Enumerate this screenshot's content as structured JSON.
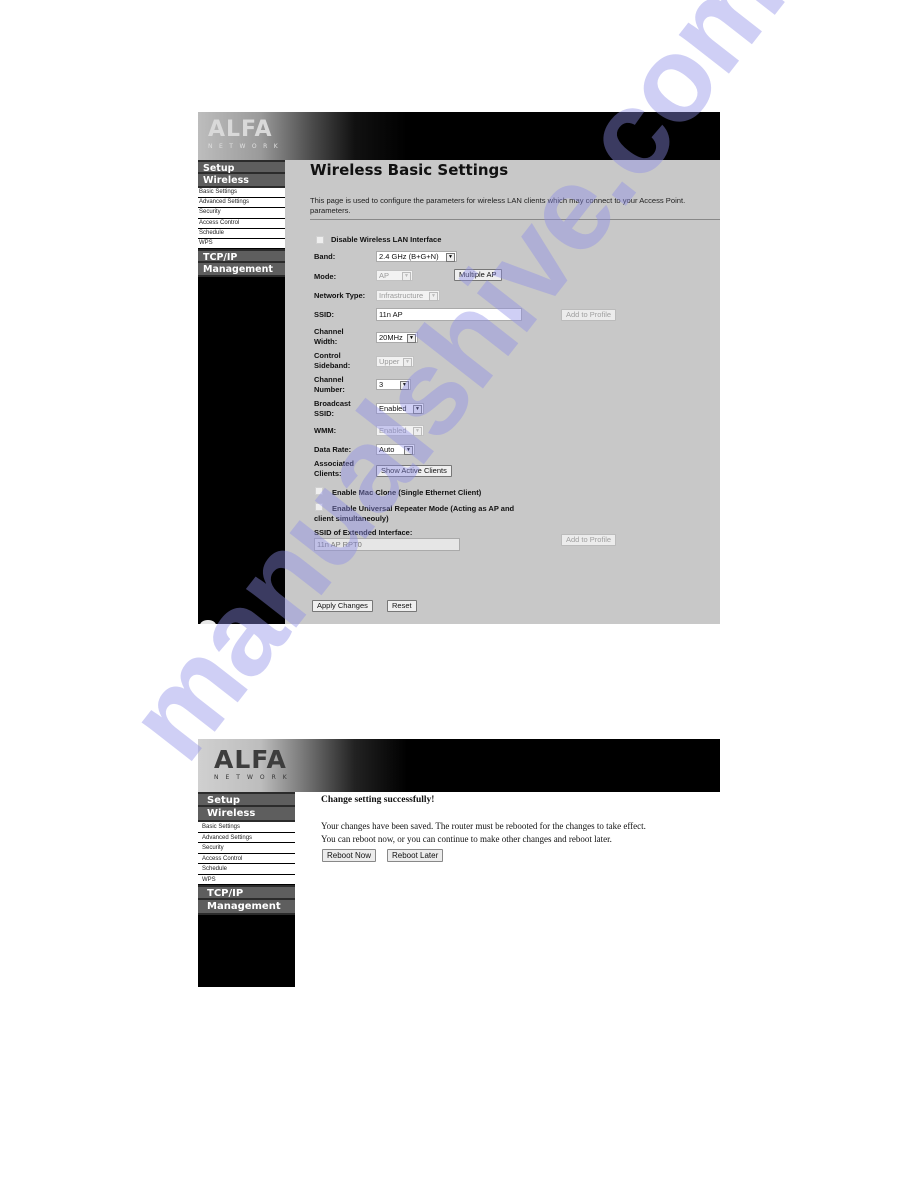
{
  "brand": {
    "logo_word": "ALFA",
    "logo_sub": "NETWORK"
  },
  "sidebar": {
    "sections": [
      {
        "label": "Setup"
      },
      {
        "label": "Wireless"
      },
      {
        "label": "TCP/IP"
      },
      {
        "label": "Management"
      }
    ],
    "wireless_items": [
      {
        "label": "Basic Settings"
      },
      {
        "label": "Advanced Settings"
      },
      {
        "label": "Security"
      },
      {
        "label": "Access Control"
      },
      {
        "label": "Schedule"
      },
      {
        "label": "WPS"
      }
    ]
  },
  "settings_page": {
    "title": "Wireless Basic Settings",
    "description": "This page is used to configure the parameters for wireless LAN clients which may connect to your Access Point.",
    "description_line2": "parameters.",
    "disable_wlan": {
      "label": "Disable Wireless LAN Interface",
      "checked": false
    },
    "band": {
      "label": "Band:",
      "value": "2.4 GHz (B+G+N)"
    },
    "mode": {
      "label": "Mode:",
      "value": "AP",
      "multiple_ap_button": "Multiple AP"
    },
    "network_type": {
      "label": "Network Type:",
      "value": "Infrastructure"
    },
    "ssid": {
      "label": "SSID:",
      "value": "11n AP",
      "add_to_profile_button": "Add to Profile"
    },
    "channel_width": {
      "label_line1": "Channel",
      "label_line2": "Width:",
      "value": "20MHz"
    },
    "control_sideband": {
      "label_line1": "Control",
      "label_line2": "Sideband:",
      "value": "Upper"
    },
    "channel_number": {
      "label_line1": "Channel",
      "label_line2": "Number:",
      "value": "3"
    },
    "broadcast_ssid": {
      "label_line1": "Broadcast",
      "label_line2": "SSID:",
      "value": "Enabled"
    },
    "wmm": {
      "label": "WMM:",
      "value": "Enabled"
    },
    "data_rate": {
      "label": "Data Rate:",
      "value": "Auto"
    },
    "associated_clients": {
      "label_line1": "Associated",
      "label_line2": "Clients:",
      "button": "Show Active Clients"
    },
    "mac_clone": {
      "label": "Enable Mac Clone (Single Ethernet Client)",
      "checked": false
    },
    "universal_repeater": {
      "label_line1": "Enable Universal Repeater Mode (Acting as AP and",
      "label_line2": "client simultaneouly)",
      "checked": false
    },
    "extended_ssid": {
      "label": "SSID of Extended Interface:",
      "value": "11n AP RPT0",
      "add_to_profile_button": "Add to Profile"
    },
    "apply_button": "Apply Changes",
    "reset_button": "Reset"
  },
  "success_page": {
    "title": "Change setting successfully!",
    "message_line1": "Your changes have been saved. The router must be rebooted for the changes to take effect.",
    "message_line2": "You can reboot now, or you can continue to make other changes and reboot later.",
    "reboot_now_button": "Reboot Now",
    "reboot_later_button": "Reboot Later"
  },
  "watermark": "manualshive.com"
}
